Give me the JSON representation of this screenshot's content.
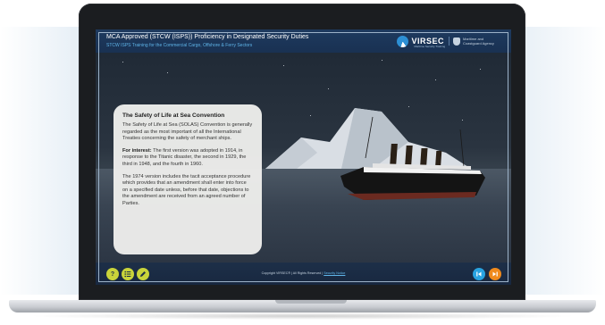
{
  "header": {
    "course_title": "MCA Approved (STCW (ISPS)) Proficiency in Designated Security Duties",
    "course_subtitle": "STCW ISPS Training for the Commercial Cargo, Offshore & Ferry Sectors",
    "logo_text": "VIRSEC",
    "logo_tagline": "Maritime Security Training",
    "partner_text": "Maritime and Coastguard Agency"
  },
  "card": {
    "title": "The Safety of Life at Sea Convention",
    "p1": "The Safety of Life at Sea (SOLAS) Convention is generally regarded as the most important of all the International Treaties concerning the safety of merchant ships.",
    "p2_label": "For interest:",
    "p2": " The first version was adopted in 1914, in response to the Titanic disaster, the second in 1929, the third in 1948, and the fourth in 1960.",
    "p3": "The 1974 version includes the tacit acceptance procedure which provides that an amendment shall enter into force on a specified date unless, before that date, objections to the amendment are received from an agreed number of Parties."
  },
  "footer": {
    "help_symbol": "?",
    "copyright": "Copyright VIRSEC® | All Rights Reserved |",
    "copyright_link": "Security Notice"
  },
  "icons": [
    "help-icon",
    "menu-list-icon",
    "notes-pencil-icon",
    "previous-icon",
    "next-icon"
  ],
  "colors": {
    "header_bg": "#1e3a5f",
    "accent_yellow": "#c9d43a",
    "accent_blue": "#29a3e0",
    "accent_orange": "#f08a1c",
    "subtitle": "#5fb4e8"
  }
}
